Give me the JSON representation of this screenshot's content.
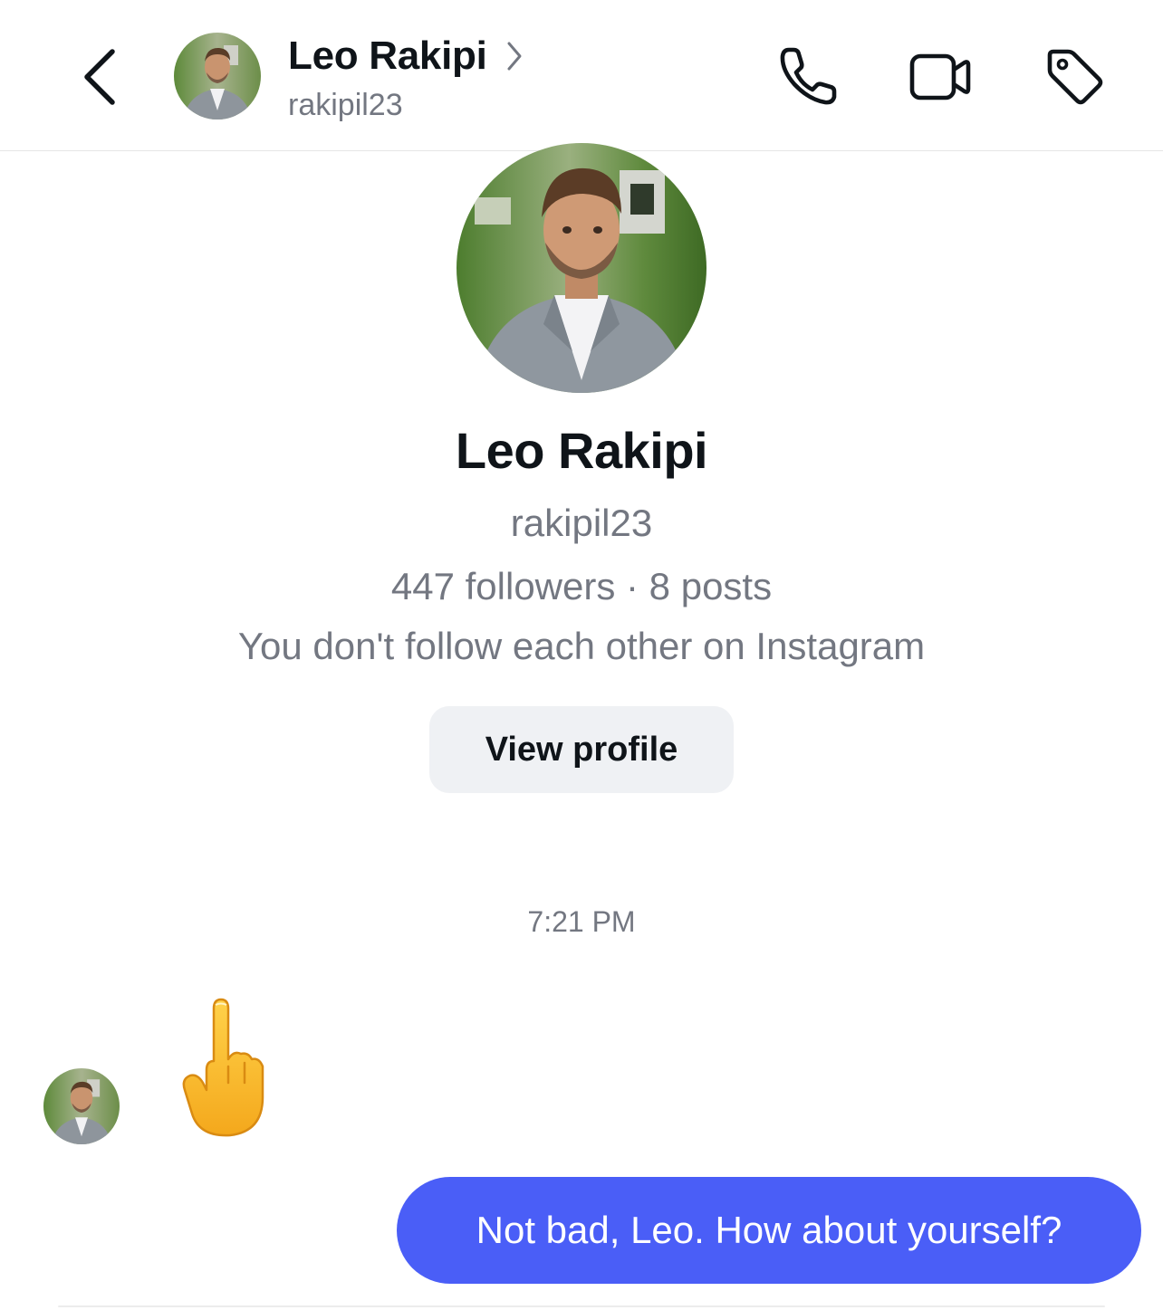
{
  "header": {
    "name": "Leo Rakipi",
    "username": "rakipil23",
    "icons": {
      "back": "chevron-left-icon",
      "name_chevron": "chevron-right-icon",
      "call": "phone-icon",
      "video": "video-camera-icon",
      "tag": "tag-icon"
    }
  },
  "profile": {
    "name": "Leo Rakipi",
    "username": "rakipil23",
    "stats": "447 followers · 8 posts",
    "follow_status": "You don't follow each other on Instagram",
    "view_profile_label": "View profile"
  },
  "conversation": {
    "timestamp": "7:21 PM",
    "received_emoji": "🖕",
    "sent_message": "Not bad, Leo. How about yourself?"
  },
  "colors": {
    "sent_bubble": "#4a5ef7",
    "secondary_text": "#737781",
    "button_bg": "#eff1f4"
  }
}
